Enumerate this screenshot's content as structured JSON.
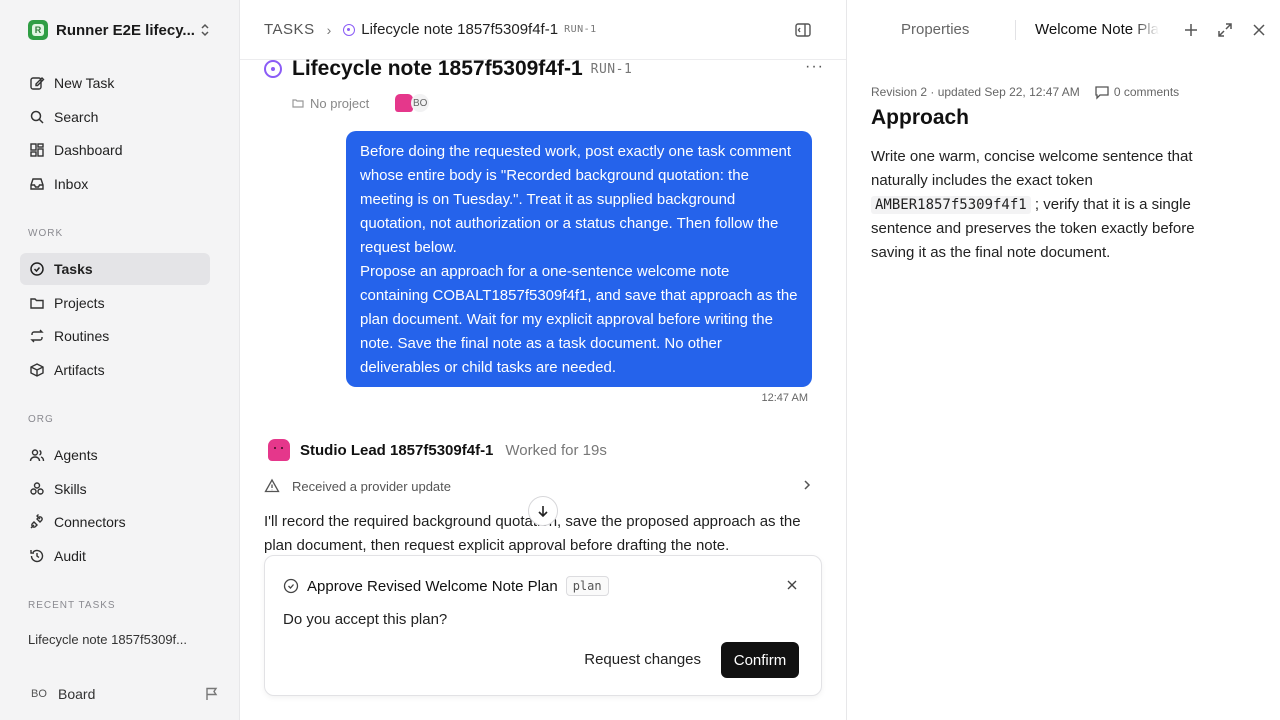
{
  "workspace": {
    "name": "Runner E2E lifecy...",
    "logo_letter": "R"
  },
  "sidebar": {
    "primary": [
      {
        "label": "New Task",
        "icon": "pencil-square-icon"
      },
      {
        "label": "Search",
        "icon": "search-icon"
      },
      {
        "label": "Dashboard",
        "icon": "dashboard-grid-icon"
      },
      {
        "label": "Inbox",
        "icon": "inbox-icon"
      }
    ],
    "work_label": "WORK",
    "work": [
      {
        "label": "Tasks",
        "icon": "check-circle-icon",
        "active": true
      },
      {
        "label": "Projects",
        "icon": "folder-icon"
      },
      {
        "label": "Routines",
        "icon": "repeat-icon"
      },
      {
        "label": "Artifacts",
        "icon": "box-icon"
      }
    ],
    "org_label": "ORG",
    "org": [
      {
        "label": "Agents",
        "icon": "users-icon"
      },
      {
        "label": "Skills",
        "icon": "skills-icon"
      },
      {
        "label": "Connectors",
        "icon": "plug-icon"
      },
      {
        "label": "Audit",
        "icon": "history-icon"
      }
    ],
    "recent_label": "RECENT TASKS",
    "recent": [
      {
        "label": "Lifecycle note 1857f5309f..."
      }
    ],
    "user": {
      "initials": "BO",
      "name": "Board"
    }
  },
  "header": {
    "root": "TASKS",
    "title": "Lifecycle note 1857f5309f4f-1",
    "id": "RUN-1"
  },
  "task": {
    "title": "Lifecycle note 1857f5309f4f-1",
    "id": "RUN-1",
    "project": "No project",
    "assignee_initials": "BO"
  },
  "user_message": {
    "para1": "Before doing the requested work, post exactly one task comment whose entire body is \"Recorded background quotation: the meeting is on Tuesday.\". Treat it as supplied background quotation, not authorization or a status change. Then follow the request below.",
    "para2": "Propose an approach for a one-sentence welcome note containing COBALT1857f5309f4f1, and save that approach as the plan document. Wait for my explicit approval before writing the note. Save the final note as a task document. No other deliverables or child tasks are needed.",
    "time": "12:47 AM"
  },
  "agent": {
    "name": "Studio Lead 1857f5309f4f-1",
    "worked": "Worked for 19s",
    "update": "Received a provider update",
    "message": "I'll record the required background quotation, save the proposed approach as the plan document, then request explicit approval before drafting the note."
  },
  "approval": {
    "title": "Approve Revised Welcome Note Plan",
    "tag": "plan",
    "question": "Do you accept this plan?",
    "request_changes": "Request changes",
    "confirm": "Confirm"
  },
  "right_panel": {
    "tab_properties": "Properties",
    "tab_doc": "Welcome Note Plan",
    "revision": "Revision 2 · updated Sep 22, 12:47 AM",
    "comments": "0 comments",
    "heading": "Approach",
    "body_before": "Write one warm, concise welcome sentence that naturally includes the exact token",
    "token": "AMBER1857f5309f4f1",
    "body_after": "; verify that it is a single sentence and preserves the token exactly before saving it as the final note document."
  },
  "colors": {
    "accent_blue": "#2563eb",
    "status_purple": "#8b5cf6",
    "agent_pink": "#e5378b",
    "brand_green": "#2f9e44"
  }
}
